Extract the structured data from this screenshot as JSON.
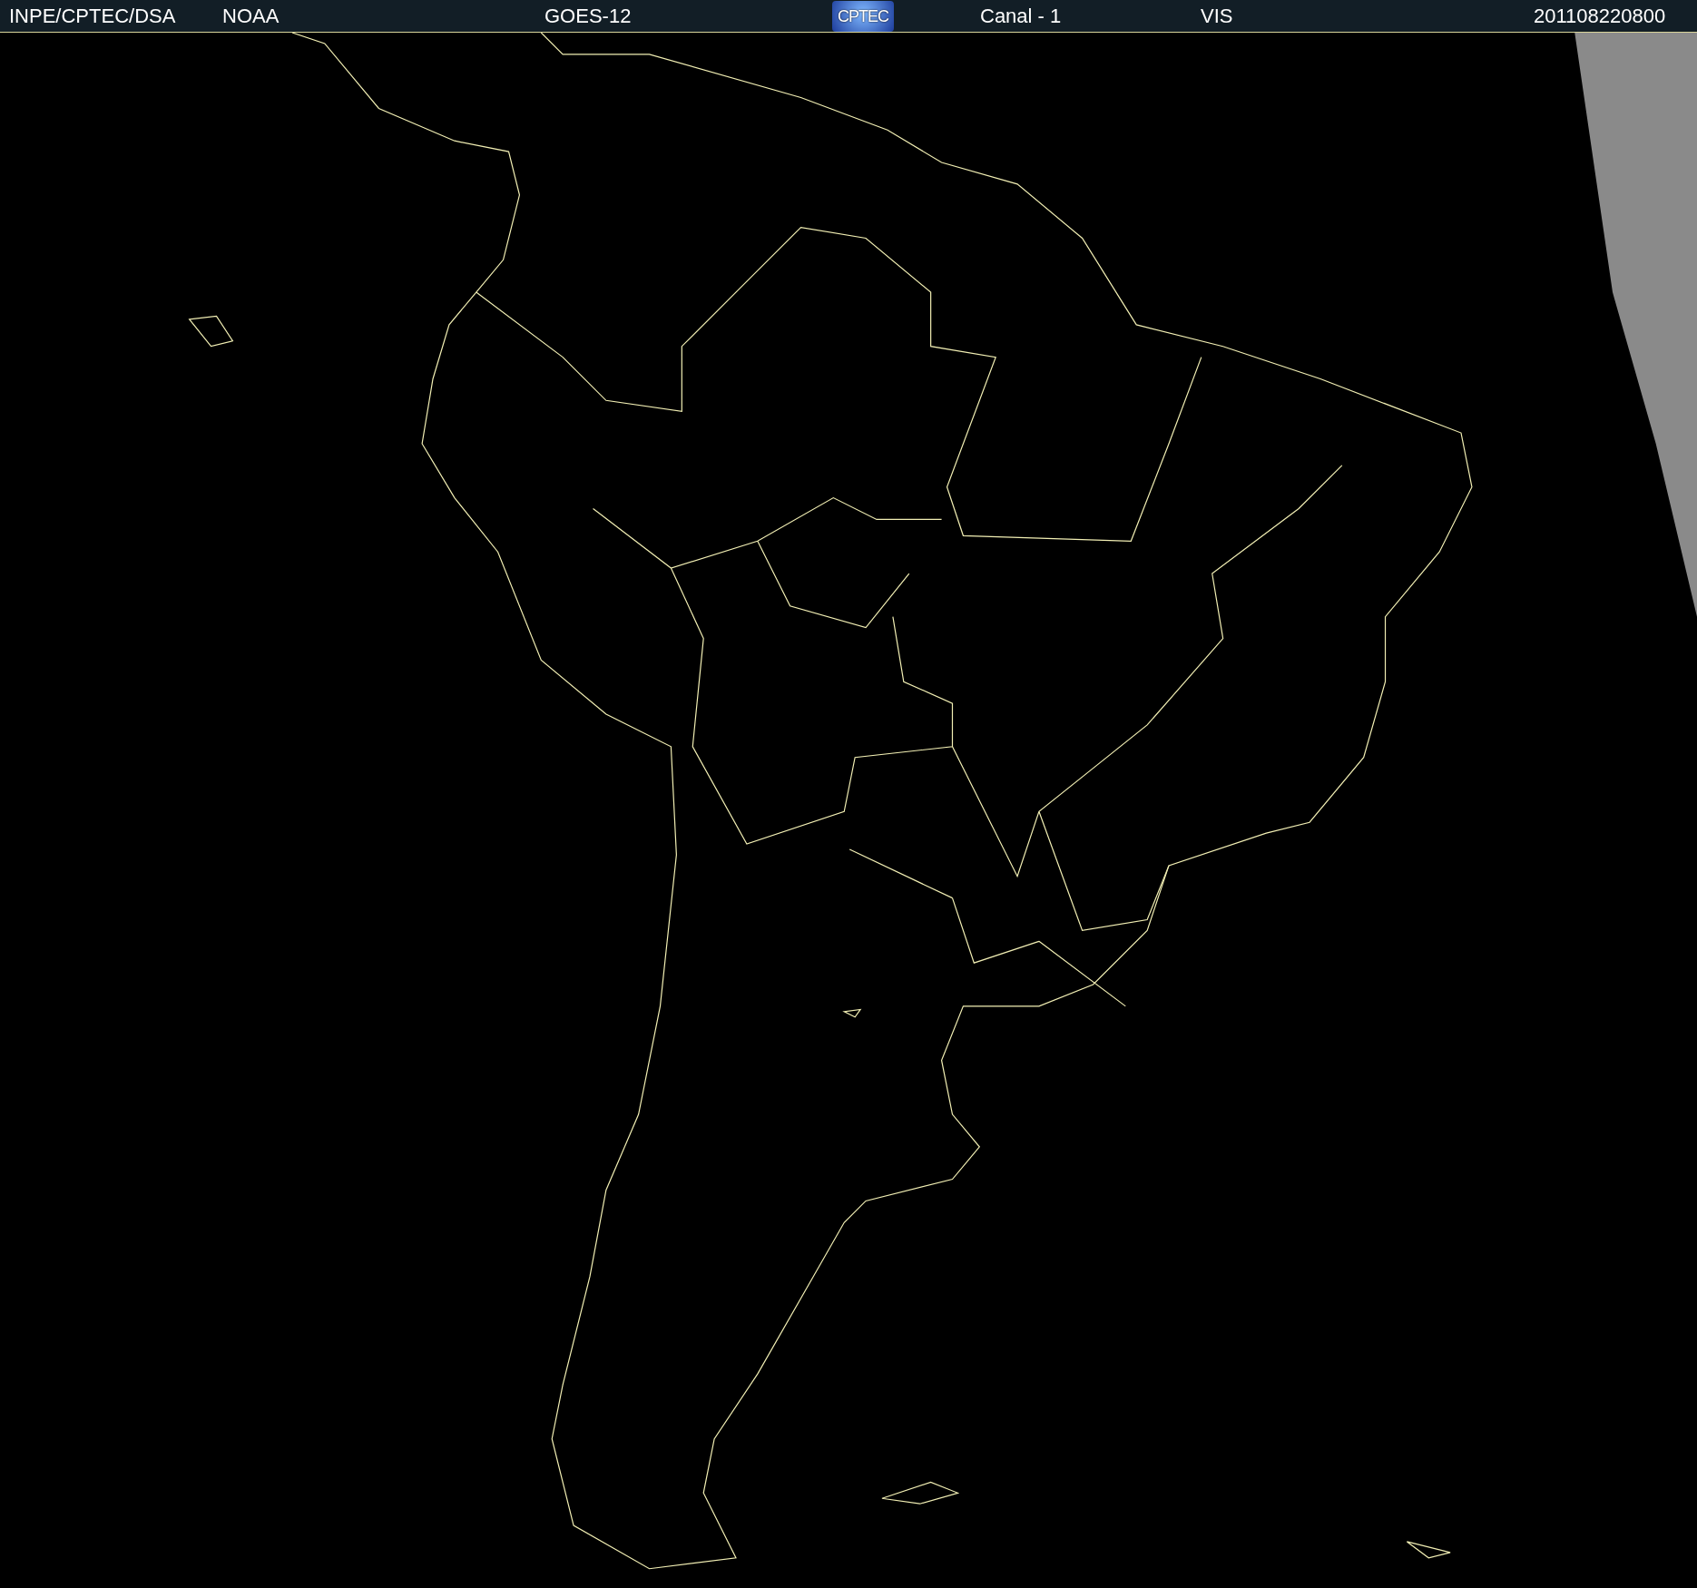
{
  "header": {
    "items": [
      {
        "kind": "text",
        "text": "INPE/CPTEC/DSA"
      },
      {
        "kind": "text",
        "text": "NOAA"
      },
      {
        "kind": "text",
        "text": "GOES-12"
      },
      {
        "kind": "logo",
        "text": "CPTEC"
      },
      {
        "kind": "text",
        "text": "Canal - 1"
      },
      {
        "kind": "text",
        "text": "VIS"
      },
      {
        "kind": "text",
        "text": "201108220800"
      }
    ]
  }
}
